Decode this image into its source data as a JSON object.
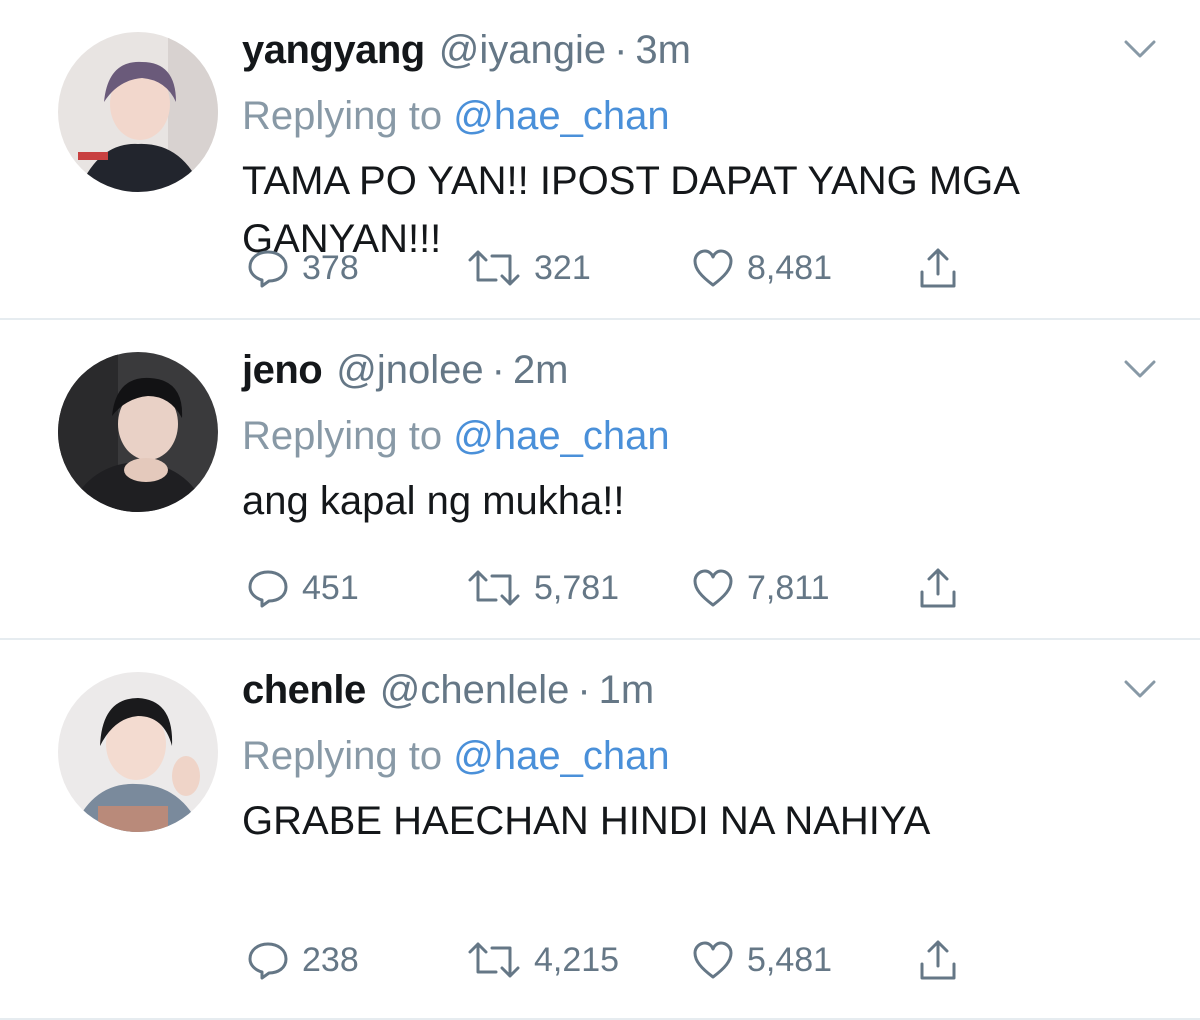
{
  "tweets": [
    {
      "name": "yangyang",
      "handle": "@iyangie",
      "dot": "·",
      "time": "3m",
      "replying_prefix": "Replying to",
      "replying_to": "@hae_chan",
      "text": "TAMA PO YAN!! IPOST DAPAT YANG MGA GANYAN!!!",
      "replies": "378",
      "retweets": "321",
      "likes": "8,481"
    },
    {
      "name": "jeno",
      "handle": "@jnolee",
      "dot": "·",
      "time": "2m",
      "replying_prefix": "Replying to",
      "replying_to": "@hae_chan",
      "text": "ang kapal ng mukha!!",
      "replies": "451",
      "retweets": "5,781",
      "likes": "7,811"
    },
    {
      "name": "chenle",
      "handle": "@chenlele",
      "dot": "·",
      "time": "1m",
      "replying_prefix": "Replying to",
      "replying_to": "@hae_chan",
      "text": "GRABE HAECHAN HINDI NA NAHIYA",
      "replies": "238",
      "retweets": "4,215",
      "likes": "5,481"
    }
  ],
  "colors": {
    "secondary_text": "#657786",
    "mention": "#4a90d9",
    "divider": "#e6ecf0"
  },
  "icons": [
    "reply-icon",
    "retweet-icon",
    "like-icon",
    "share-icon",
    "chevron-down-icon"
  ]
}
